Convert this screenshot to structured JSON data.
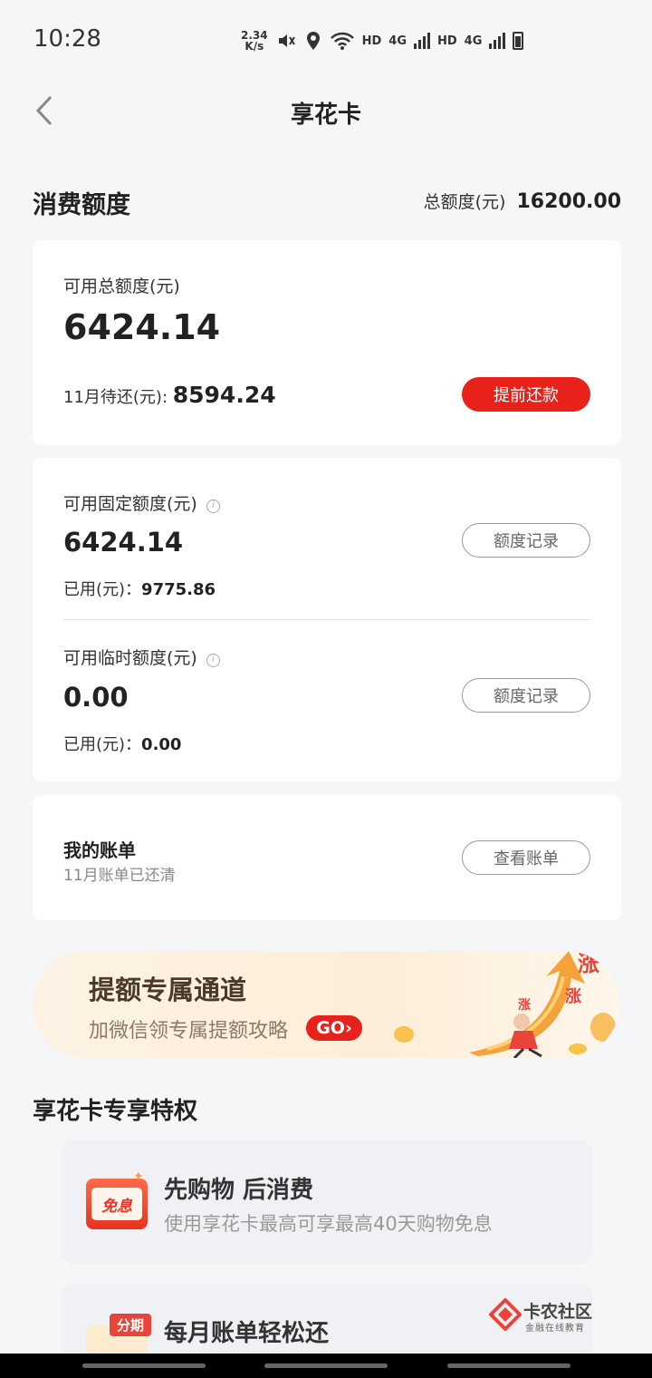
{
  "status_bar": {
    "time": "10:28",
    "net_speed_value": "2.34",
    "net_speed_unit": "K/s",
    "hd1": "HD",
    "net1": "4G",
    "hd2": "HD",
    "net2": "4G"
  },
  "header": {
    "title": "享花卡"
  },
  "consumption": {
    "section_title": "消费额度",
    "total_limit_label": "总额度(元)",
    "total_limit_value": "16200.00"
  },
  "available_card": {
    "label": "可用总额度(元)",
    "amount": "6424.14",
    "due_label": "11月待还(元):",
    "due_amount": "8594.24",
    "repay_button": "提前还款"
  },
  "fixed_limit": {
    "label": "可用固定额度(元)",
    "amount": "6424.14",
    "used_label": "已用(元)：",
    "used_value": "9775.86",
    "record_button": "额度记录"
  },
  "temp_limit": {
    "label": "可用临时额度(元)",
    "amount": "0.00",
    "used_label": "已用(元)：",
    "used_value": "0.00",
    "record_button": "额度记录"
  },
  "bill_card": {
    "title": "我的账单",
    "subtitle": "11月账单已还清",
    "view_button": "查看账单"
  },
  "banner": {
    "title": "提额专属通道",
    "subtitle": "加微信领专属提额攻略",
    "go": "GO",
    "art_text": "涨"
  },
  "perks": {
    "title": "享花卡专享特权",
    "items": [
      {
        "title": "先购物 后消费",
        "desc": "使用享花卡最高可享最高40天购物免息",
        "icon_text": "免息",
        "icon": "interest-free-icon"
      },
      {
        "title": "每月账单轻松还",
        "icon_text": "分期",
        "icon": "installment-icon"
      }
    ]
  },
  "watermark": {
    "title": "卡农社区",
    "subtitle": "金融在线教育"
  },
  "colors": {
    "accent_red": "#e8211a",
    "page_bg": "#f5f6f8",
    "card_bg": "#ffffff"
  }
}
